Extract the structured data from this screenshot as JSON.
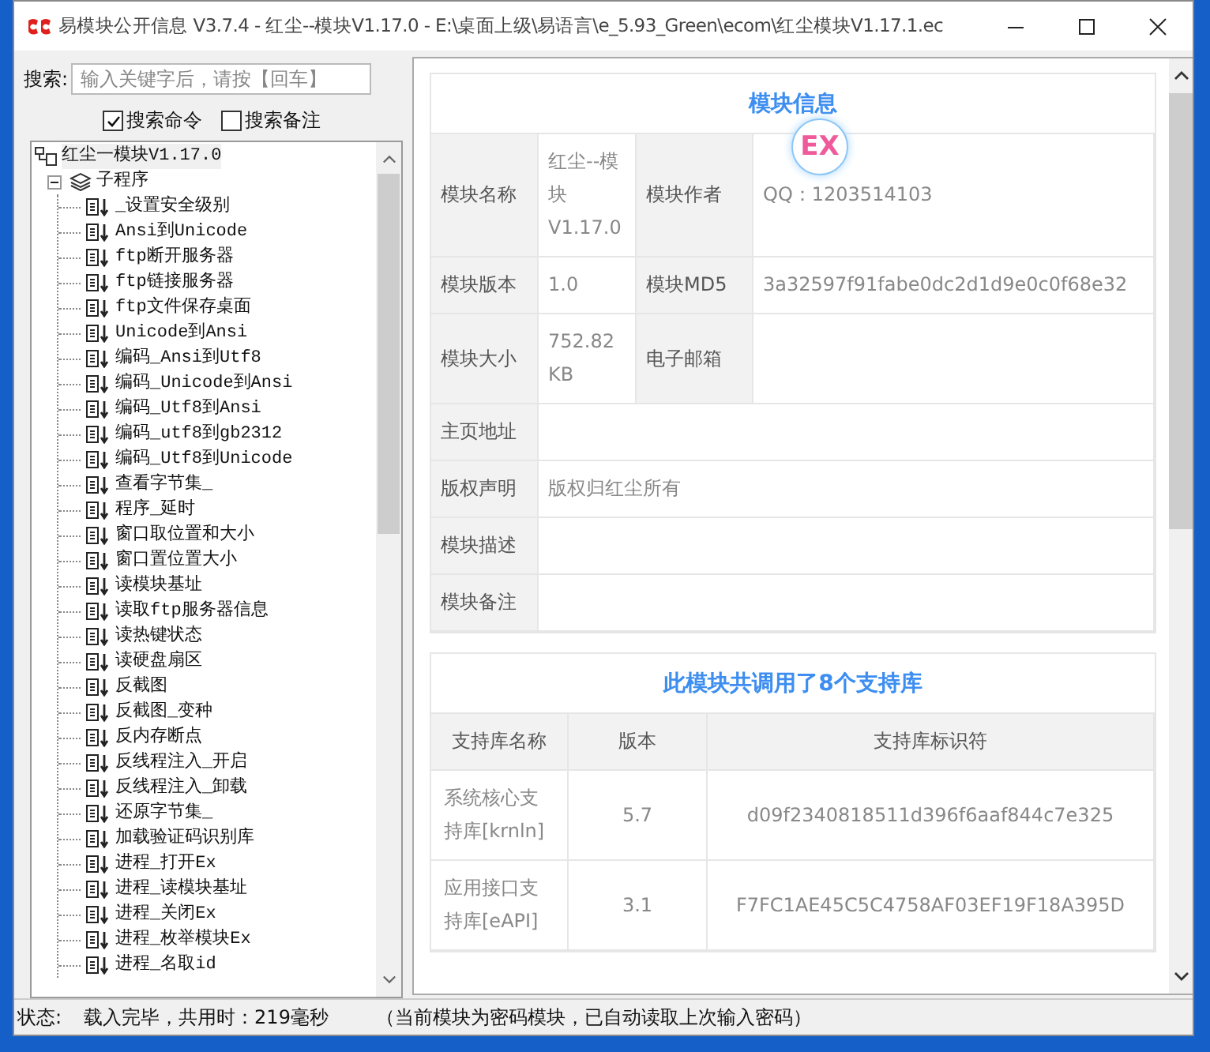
{
  "window": {
    "title": "易模块公开信息 V3.7.4 - 红尘--模块V1.17.0 - E:\\桌面上级\\易语言\\e_5.93_Green\\ecom\\红尘模块V1.17.1.ec"
  },
  "search": {
    "label": "搜索:",
    "placeholder": "输入关键字后，请按【回车】"
  },
  "options": [
    {
      "label": "搜索命令",
      "checked": true
    },
    {
      "label": "搜索备注",
      "checked": false
    }
  ],
  "tree": {
    "label": "红尘一模块V1.17.0",
    "children": [
      {
        "label": "子程序",
        "expanded": true,
        "children": [
          {
            "label": "_设置安全级别"
          },
          {
            "label": "Ansi到Unicode"
          },
          {
            "label": "ftp断开服务器"
          },
          {
            "label": "ftp链接服务器"
          },
          {
            "label": "ftp文件保存桌面"
          },
          {
            "label": "Unicode到Ansi"
          },
          {
            "label": "编码_Ansi到Utf8"
          },
          {
            "label": "编码_Unicode到Ansi"
          },
          {
            "label": "编码_Utf8到Ansi"
          },
          {
            "label": "编码_utf8到gb2312"
          },
          {
            "label": "编码_Utf8到Unicode"
          },
          {
            "label": "查看字节集_"
          },
          {
            "label": "程序_延时"
          },
          {
            "label": "窗口取位置和大小"
          },
          {
            "label": "窗口置位置大小"
          },
          {
            "label": "读模块基址"
          },
          {
            "label": "读取ftp服务器信息"
          },
          {
            "label": "读热键状态"
          },
          {
            "label": "读硬盘扇区"
          },
          {
            "label": "反截图"
          },
          {
            "label": "反截图_变种"
          },
          {
            "label": "反内存断点"
          },
          {
            "label": "反线程注入_开启"
          },
          {
            "label": "反线程注入_卸载"
          },
          {
            "label": "还原字节集_"
          },
          {
            "label": "加载验证码识别库"
          },
          {
            "label": "进程_打开Ex"
          },
          {
            "label": "进程_读模块基址"
          },
          {
            "label": "进程_关闭Ex"
          },
          {
            "label": "进程_枚举模块Ex"
          },
          {
            "label": "进程_名取id"
          }
        ]
      }
    ]
  },
  "module_info": {
    "title": "模块信息",
    "badge": "EX",
    "rows": [
      {
        "fields": [
          {
            "label": "模块名称",
            "value": "红尘--模块V1.17.0"
          },
          {
            "label": "模块作者",
            "value": "QQ：1203514103"
          }
        ]
      },
      {
        "fields": [
          {
            "label": "模块版本",
            "value": "1.0"
          },
          {
            "label": "模块MD5",
            "value": "3a32597f91fabe0dc2d1d9e0c0f68e32"
          }
        ]
      },
      {
        "fields": [
          {
            "label": "模块大小",
            "value": "752.82 KB"
          },
          {
            "label": "电子邮箱"
          }
        ]
      },
      {
        "fields": [
          {
            "label": "主页地址"
          }
        ]
      },
      {
        "fields": [
          {
            "label": "版权声明",
            "value": "版权归红尘所有"
          }
        ]
      },
      {
        "fields": [
          {
            "label": "模块描述"
          }
        ]
      },
      {
        "fields": [
          {
            "label": "模块备注"
          }
        ]
      }
    ]
  },
  "libraries": {
    "title": "此模块共调用了8个支持库",
    "columns": [
      "支持库名称",
      "版本",
      "支持库标识符"
    ],
    "rows": [
      [
        "系统核心支持库[krnln]",
        "5.7",
        "d09f2340818511d396f6aaf844c7e325"
      ],
      [
        "应用接口支持库[eAPI]",
        "3.1",
        "F7FC1AE45C5C4758AF03EF19F18A395D"
      ]
    ]
  },
  "status_bar": {
    "label": "状态:",
    "message": "载入完毕，共用时：219毫秒",
    "note": "（当前模块为密码模块，已自动读取上次输入密码）"
  }
}
